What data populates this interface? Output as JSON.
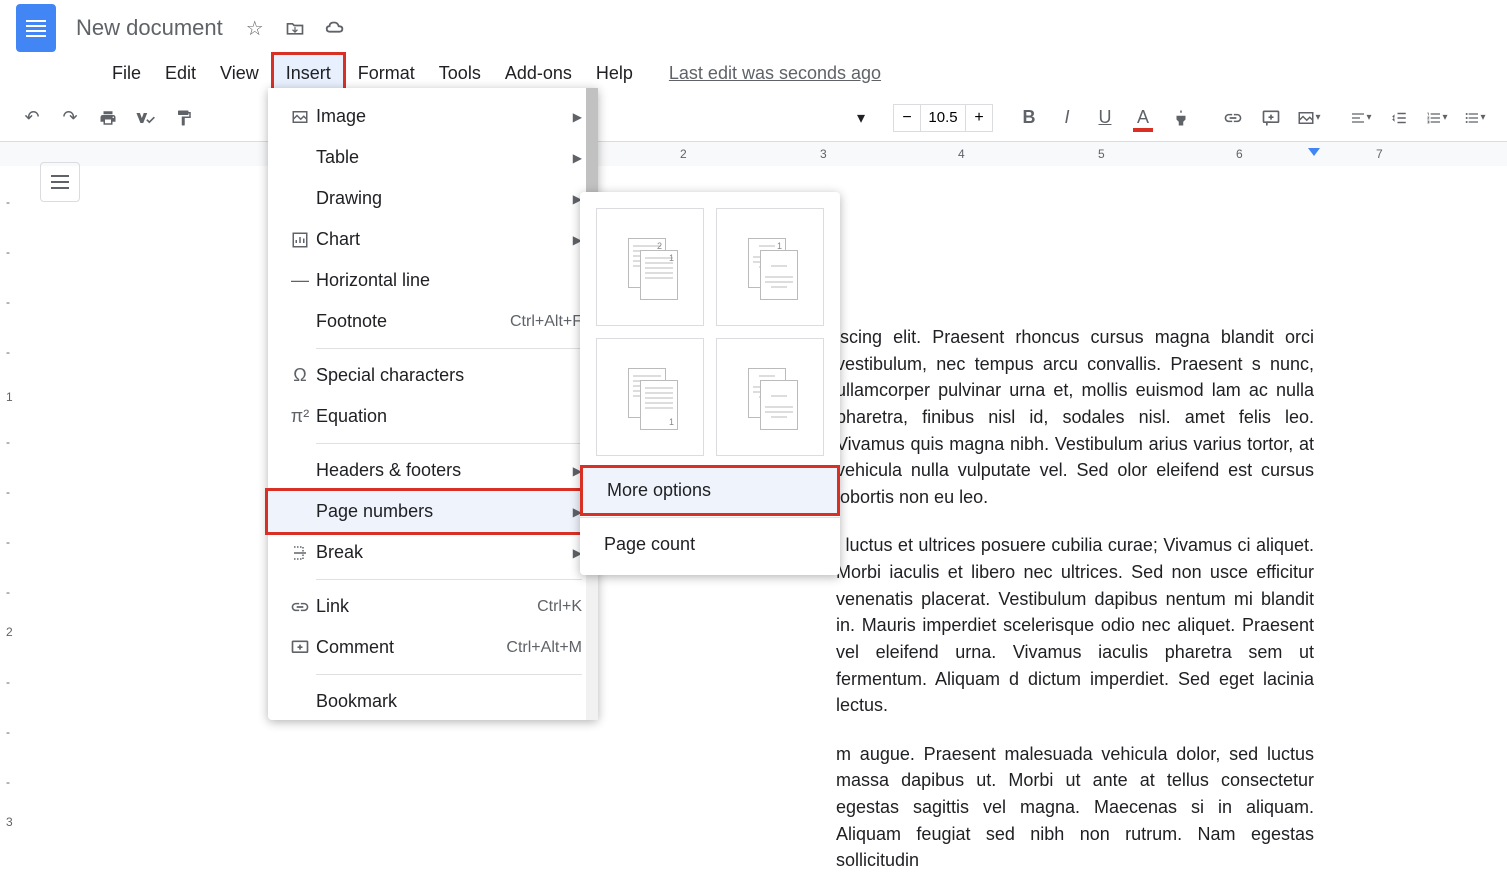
{
  "header": {
    "title": "New document"
  },
  "menubar": {
    "items": [
      "File",
      "Edit",
      "View",
      "Insert",
      "Format",
      "Tools",
      "Add-ons",
      "Help"
    ],
    "active": "Insert",
    "last_edit": "Last edit was seconds ago"
  },
  "toolbar": {
    "font_size": "10.5"
  },
  "ruler": {
    "nums": [
      "2",
      "3",
      "4",
      "5",
      "6",
      "7"
    ]
  },
  "vruler": {
    "nums": [
      "1",
      "2",
      "3"
    ]
  },
  "dropdown": {
    "items": [
      {
        "icon": "image",
        "label": "Image",
        "arrow": true
      },
      {
        "icon": "",
        "label": "Table",
        "arrow": true
      },
      {
        "icon": "",
        "label": "Drawing",
        "arrow": true
      },
      {
        "icon": "chart",
        "label": "Chart",
        "arrow": true
      },
      {
        "icon": "hline",
        "label": "Horizontal line"
      },
      {
        "icon": "",
        "label": "Footnote",
        "shortcut": "Ctrl+Alt+F"
      },
      {
        "divider": true
      },
      {
        "icon": "omega",
        "label": "Special characters"
      },
      {
        "icon": "pi",
        "label": "Equation"
      },
      {
        "divider": true
      },
      {
        "icon": "",
        "label": "Headers & footers",
        "arrow": true
      },
      {
        "icon": "",
        "label": "Page numbers",
        "arrow": true,
        "highlighted": true
      },
      {
        "icon": "break",
        "label": "Break",
        "arrow": true
      },
      {
        "divider": true
      },
      {
        "icon": "link",
        "label": "Link",
        "shortcut": "Ctrl+K"
      },
      {
        "icon": "comment",
        "label": "Comment",
        "shortcut": "Ctrl+Alt+M"
      },
      {
        "divider": true
      },
      {
        "icon": "",
        "label": "Bookmark"
      }
    ]
  },
  "submenu": {
    "more_options": "More options",
    "page_count": "Page count"
  },
  "document": {
    "p1": "iscing elit. Praesent rhoncus cursus magna blandit orci vestibulum, nec tempus arcu convallis. Praesent s nunc, ullamcorper pulvinar urna et, mollis euismod lam ac nulla pharetra, finibus nisl id, sodales nisl. amet felis leo. Vivamus quis magna nibh. Vestibulum arius varius tortor, at vehicula nulla vulputate vel. Sed olor eleifend est cursus lobortis non eu leo.",
    "p2": "i luctus et ultrices posuere cubilia curae; Vivamus ci aliquet. Morbi iaculis et libero nec ultrices. Sed non usce efficitur venenatis placerat. Vestibulum dapibus nentum mi blandit in. Mauris imperdiet scelerisque odio nec aliquet. Praesent vel eleifend urna. Vivamus iaculis pharetra sem ut fermentum. Aliquam d dictum imperdiet. Sed eget lacinia lectus.",
    "p3": "m augue. Praesent malesuada vehicula dolor, sed luctus massa dapibus ut. Morbi ut ante at tellus consectetur egestas sagittis vel magna. Maecenas si in aliquam. Aliquam feugiat sed nibh non rutrum. Nam egestas sollicitudin"
  }
}
